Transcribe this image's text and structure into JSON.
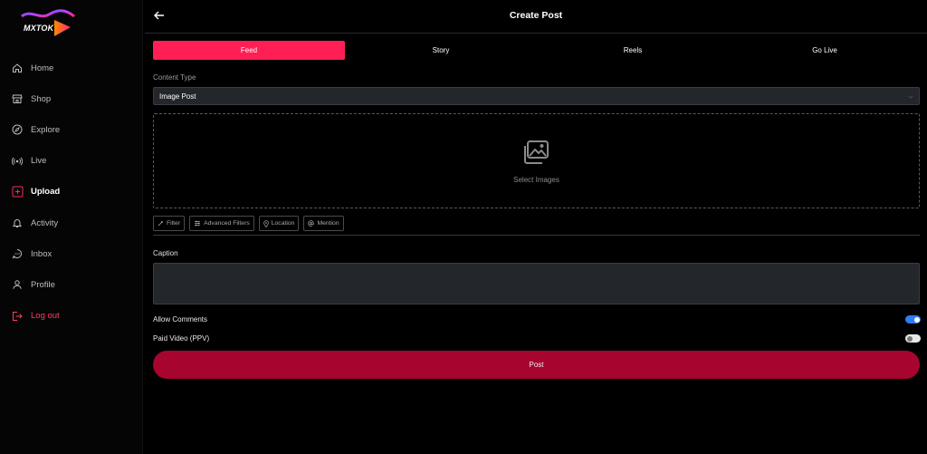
{
  "brand": {
    "name": "MXTOK"
  },
  "sidebar": {
    "items": [
      {
        "label": "Home",
        "icon": "home-icon"
      },
      {
        "label": "Shop",
        "icon": "shop-icon"
      },
      {
        "label": "Explore",
        "icon": "compass-icon"
      },
      {
        "label": "Live",
        "icon": "live-icon"
      },
      {
        "label": "Upload",
        "icon": "plus-square-icon",
        "active": true
      },
      {
        "label": "Activity",
        "icon": "bell-icon"
      },
      {
        "label": "Inbox",
        "icon": "chat-icon"
      },
      {
        "label": "Profile",
        "icon": "user-icon"
      },
      {
        "label": "Log out",
        "icon": "logout-icon"
      }
    ]
  },
  "header": {
    "title": "Create Post"
  },
  "tabs": [
    {
      "label": "Feed",
      "active": true
    },
    {
      "label": "Story"
    },
    {
      "label": "Reels"
    },
    {
      "label": "Go Live"
    }
  ],
  "content_type": {
    "label": "Content Type",
    "value": "Image Post"
  },
  "dropzone": {
    "label": "Select Images"
  },
  "tools": [
    {
      "label": "Filter",
      "icon": "wand-icon"
    },
    {
      "label": "Advanced Filters",
      "icon": "sliders-icon"
    },
    {
      "label": "Location",
      "icon": "pin-icon"
    },
    {
      "label": "Mention",
      "icon": "at-icon"
    }
  ],
  "caption": {
    "label": "Caption",
    "value": ""
  },
  "toggles": [
    {
      "label": "Allow Comments",
      "on": true
    },
    {
      "label": "Paid Video (PPV)",
      "on": false
    }
  ],
  "post_button": {
    "label": "Post"
  },
  "colors": {
    "accent": "#ff1f55",
    "post": "#a70430",
    "toggle_on": "#2f7cf6",
    "logout": "#ff3d5e"
  }
}
